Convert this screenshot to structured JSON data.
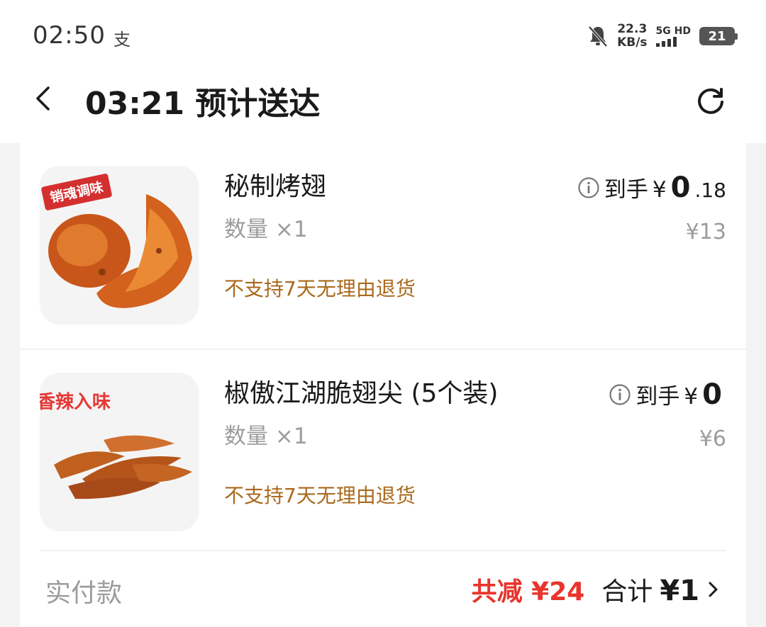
{
  "status_bar": {
    "time": "02:50",
    "app_glyph": "支",
    "speed_value": "22.3",
    "speed_unit": "KB/s",
    "network": "5G HD",
    "battery": "21",
    "icons": [
      "bell-muted-icon",
      "signal-icon",
      "battery-icon"
    ]
  },
  "header": {
    "title": "03:21 预计送达",
    "icons": [
      "back-arrow-icon",
      "refresh-icon"
    ]
  },
  "items": [
    {
      "name": "秘制烤翅",
      "qty": "数量 ×1",
      "note": "不支持7天无理由退货",
      "price_prefix": "到手",
      "price_yen": "¥",
      "price_main": "0",
      "price_decimal": ".18",
      "original_price": "¥13",
      "badge_text": "销魂调味"
    },
    {
      "name": "椒傲江湖脆翅尖 (5个装)",
      "qty": "数量 ×1",
      "note": "不支持7天无理由退货",
      "price_prefix": "到手",
      "price_yen": "¥",
      "price_main": "0",
      "price_decimal": "",
      "original_price": "¥6",
      "badge_text": "香辣入味"
    }
  ],
  "summary": {
    "label": "实付款",
    "discount": "共减 ¥24",
    "total_label": "合计",
    "total_value": "¥1"
  },
  "colors": {
    "discount": "#e8352c",
    "note": "#a9691d",
    "muted": "#9c9c9c"
  }
}
